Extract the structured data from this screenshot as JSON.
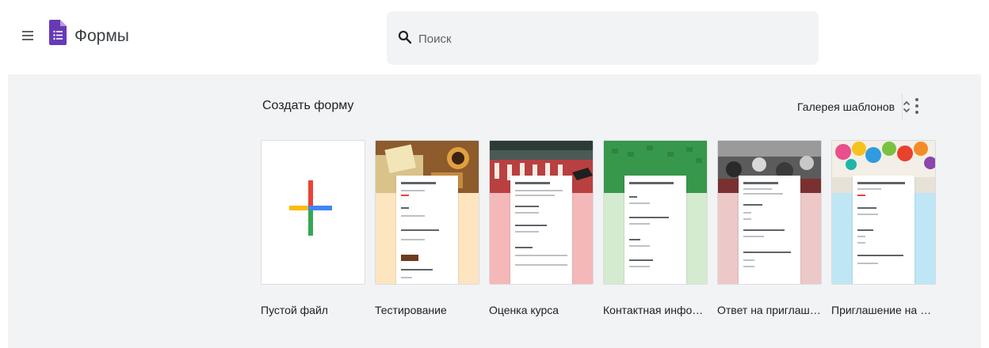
{
  "header": {
    "app_title": "Формы",
    "menu_icon": "hamburger-menu-icon",
    "logo_icon": "forms-logo-icon"
  },
  "search": {
    "placeholder": "Поиск",
    "value": "",
    "icon": "search-icon"
  },
  "gallery": {
    "title": "Создать форму",
    "template_gallery_label": "Галерея шаблонов",
    "unfold_icon": "unfold-more-icon",
    "more_icon": "more-vert-icon",
    "templates": [
      {
        "name": "Пустой файл"
      },
      {
        "name": "Тестирование"
      },
      {
        "name": "Оценка курса"
      },
      {
        "name": "Контактная информац..."
      },
      {
        "name": "Ответ на приглашение"
      },
      {
        "name": "Приглашение на вече..."
      }
    ]
  },
  "colors": {
    "background": "#f1f3f4",
    "forms_purple": "#673ab7",
    "plus_red": "#ea4335",
    "plus_blue": "#4285f4",
    "plus_yellow": "#fbbc04",
    "plus_green": "#34a853"
  }
}
